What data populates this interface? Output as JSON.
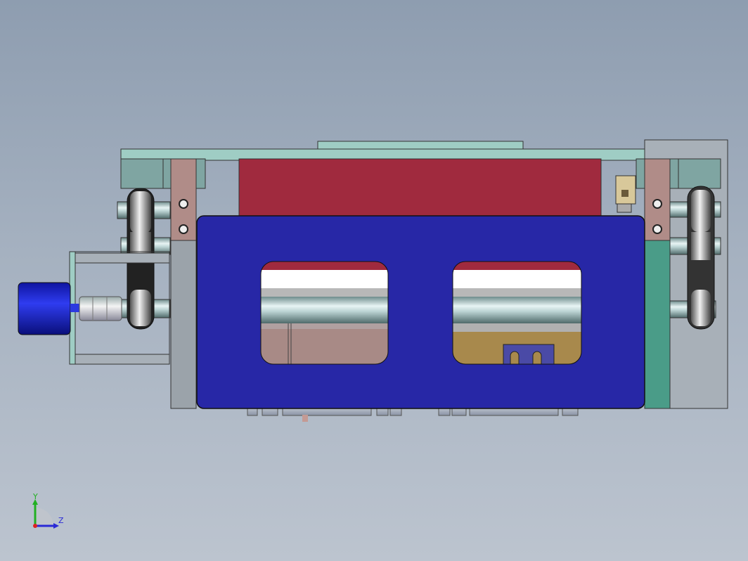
{
  "viewport": {
    "background_top": "#8e9db0",
    "background_bottom": "#bcc4cf"
  },
  "model": {
    "colors": {
      "housing_blue": "#2727a6",
      "top_red": "#a02a3e",
      "plate_teal": "#9fcdc4",
      "motor_blue": "#1b22c8",
      "shaft_steel": "#c8d6d8",
      "bracket_rose": "#b08c88",
      "side_green": "#4a9c88",
      "window_pink": "#a88a86",
      "window_ochre": "#a8894c",
      "block_purple": "#4a4aa6"
    }
  },
  "triad": {
    "y_label": "Y",
    "z_label": "Z",
    "y_color": "#22b022",
    "z_color": "#2a2ad6"
  }
}
